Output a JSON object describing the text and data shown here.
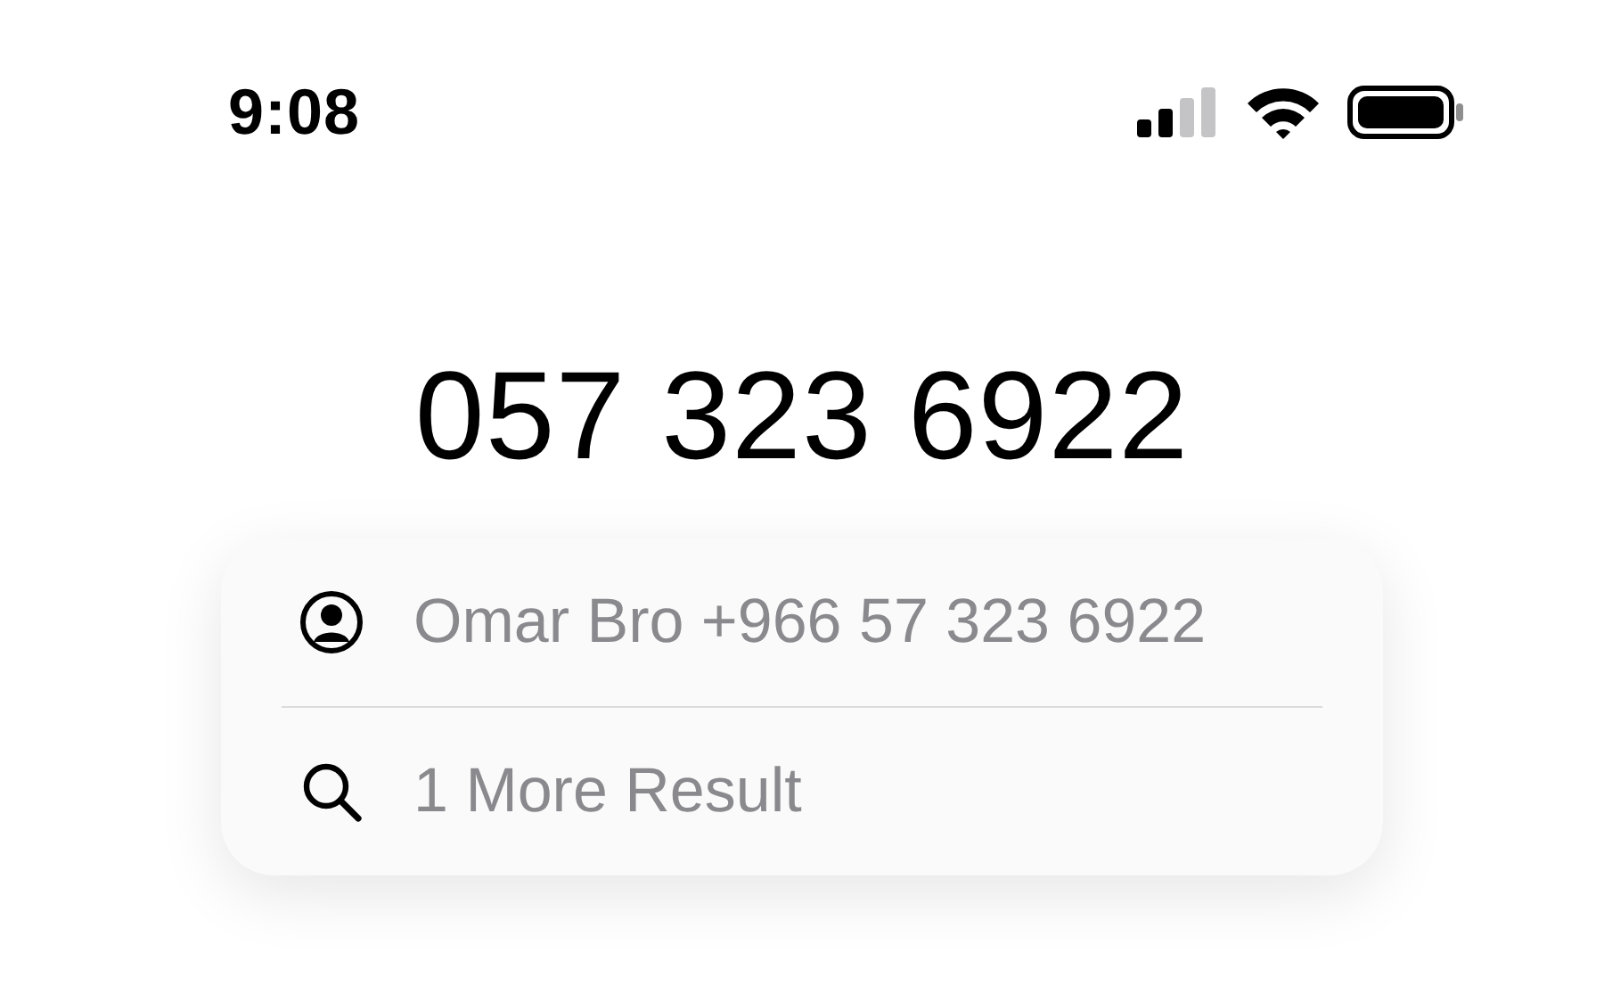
{
  "status_bar": {
    "time": "9:08"
  },
  "dialed_number": "057 323 6922",
  "suggestions": [
    {
      "kind": "contact",
      "text": "Omar Bro +966 57 323 6922"
    },
    {
      "kind": "search",
      "text": "1 More Result"
    }
  ]
}
